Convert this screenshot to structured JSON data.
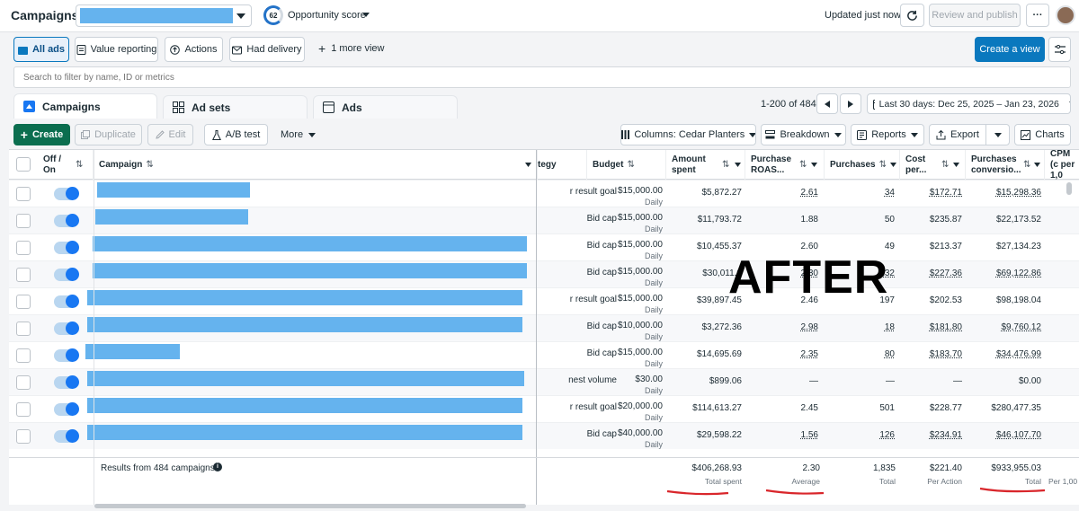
{
  "topbar": {
    "title": "Campaigns",
    "opportunity_score": "62",
    "opportunity_label": "Opportunity score",
    "updated": "Updated just now",
    "review_publish": "Review and publish",
    "more": "···"
  },
  "views": {
    "all_ads": "All ads",
    "value_reporting": "Value reporting",
    "actions": "Actions",
    "had_delivery": "Had delivery",
    "more_view": "1 more view",
    "create_view": "Create a view"
  },
  "search": {
    "placeholder": "Search to filter by name, ID or metrics"
  },
  "tabs": {
    "campaigns": "Campaigns",
    "adsets": "Ad sets",
    "ads": "Ads"
  },
  "pagination": {
    "range": "1-200 of 484",
    "date_range": "Last 30 days: Dec 25, 2025 – Jan 23, 2026"
  },
  "toolbar": {
    "create": "Create",
    "duplicate": "Duplicate",
    "edit": "Edit",
    "ab_test": "A/B test",
    "more": "More",
    "columns": "Columns: Cedar Planters",
    "breakdown": "Breakdown",
    "reports": "Reports",
    "export": "Export",
    "charts": "Charts"
  },
  "columns": {
    "off_on": "Off / On",
    "campaign": "Campaign",
    "strategy": "tegy",
    "budget": "Budget",
    "amount_spent": "Amount spent",
    "purchase_roas": "Purchase ROAS...",
    "purchases": "Purchases",
    "cost_per": "Cost per...",
    "purchases_conv": "Purchases conversio...",
    "cpm": "CPM (c per 1,0"
  },
  "rows": [
    {
      "strategy": "r result goal",
      "budget": "$15,000.00",
      "budget_type": "Daily",
      "spent": "$5,872.27",
      "roas": "2.61",
      "purchases": "34",
      "cost": "$172.71",
      "conv": "$15,298.36"
    },
    {
      "strategy": "Bid cap",
      "budget": "$15,000.00",
      "budget_type": "Daily",
      "spent": "$11,793.72",
      "roas": "1.88",
      "purchases": "50",
      "cost": "$235.87",
      "conv": "$22,173.52"
    },
    {
      "strategy": "Bid cap",
      "budget": "$15,000.00",
      "budget_type": "Daily",
      "spent": "$10,455.37",
      "roas": "2.60",
      "purchases": "49",
      "cost": "$213.37",
      "conv": "$27,134.23"
    },
    {
      "strategy": "Bid cap",
      "budget": "$15,000.00",
      "budget_type": "Daily",
      "spent": "$30,011.0",
      "roas": "2.30",
      "purchases": "132",
      "cost": "$227.36",
      "conv": "$69,122.86"
    },
    {
      "strategy": "r result goal",
      "budget": "$15,000.00",
      "budget_type": "Daily",
      "spent": "$39,897.45",
      "roas": "2.46",
      "purchases": "197",
      "cost": "$202.53",
      "conv": "$98,198.04"
    },
    {
      "strategy": "Bid cap",
      "budget": "$10,000.00",
      "budget_type": "Daily",
      "spent": "$3,272.36",
      "roas": "2.98",
      "purchases": "18",
      "cost": "$181.80",
      "conv": "$9,760.12"
    },
    {
      "strategy": "Bid cap",
      "budget": "$15,000.00",
      "budget_type": "Daily",
      "spent": "$14,695.69",
      "roas": "2.35",
      "purchases": "80",
      "cost": "$183.70",
      "conv": "$34,476.99"
    },
    {
      "strategy": "nest volume",
      "budget": "$30.00",
      "budget_type": "Daily",
      "spent": "$899.06",
      "roas": "—",
      "purchases": "—",
      "cost": "—",
      "conv": "$0.00"
    },
    {
      "strategy": "r result goal",
      "budget": "$20,000.00",
      "budget_type": "Daily",
      "spent": "$114,613.27",
      "roas": "2.45",
      "purchases": "501",
      "cost": "$228.77",
      "conv": "$280,477.35"
    },
    {
      "strategy": "Bid cap",
      "budget": "$40,000.00",
      "budget_type": "Daily",
      "spent": "$29,598.22",
      "roas": "1.56",
      "purchases": "126",
      "cost": "$234.91",
      "conv": "$46,107.70"
    }
  ],
  "footer": {
    "results": "Results from 484 campaigns",
    "spent": "$406,268.93",
    "spent_label": "Total spent",
    "roas": "2.30",
    "roas_label": "Average",
    "purchases": "1,835",
    "purchases_label": "Total",
    "cost": "$221.40",
    "cost_label": "Per Action",
    "conv": "$933,955.03",
    "conv_label": "Total",
    "cpm_label": "Per 1,00"
  },
  "overlay": {
    "text": "AFTER",
    "underline_color": "#d9262b"
  }
}
